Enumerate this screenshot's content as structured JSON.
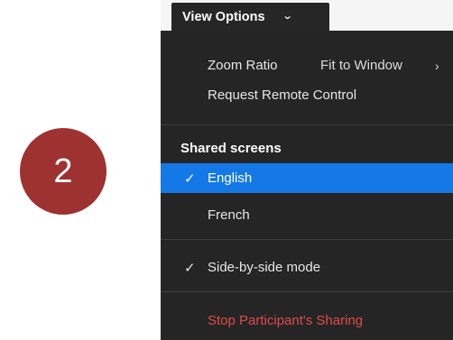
{
  "step": {
    "number": "2",
    "color": "#9e3231"
  },
  "view_options": {
    "label": "View Options",
    "icon": "chevron-down-icon"
  },
  "menu": {
    "zoom": {
      "label": "Zoom Ratio",
      "value": "Fit to Window",
      "arrow": "›"
    },
    "remote_control": "Request Remote Control",
    "shared_screens_heading": "Shared screens",
    "screens": [
      {
        "label": "English",
        "selected": true
      },
      {
        "label": "French",
        "selected": false
      }
    ],
    "side_by_side": {
      "label": "Side-by-side mode",
      "checked": true
    },
    "stop_sharing": "Stop Participant's Sharing",
    "check_glyph": "✓"
  },
  "colors": {
    "menu_bg": "#252525",
    "highlight": "#1478e6",
    "danger": "#e04a4a"
  }
}
